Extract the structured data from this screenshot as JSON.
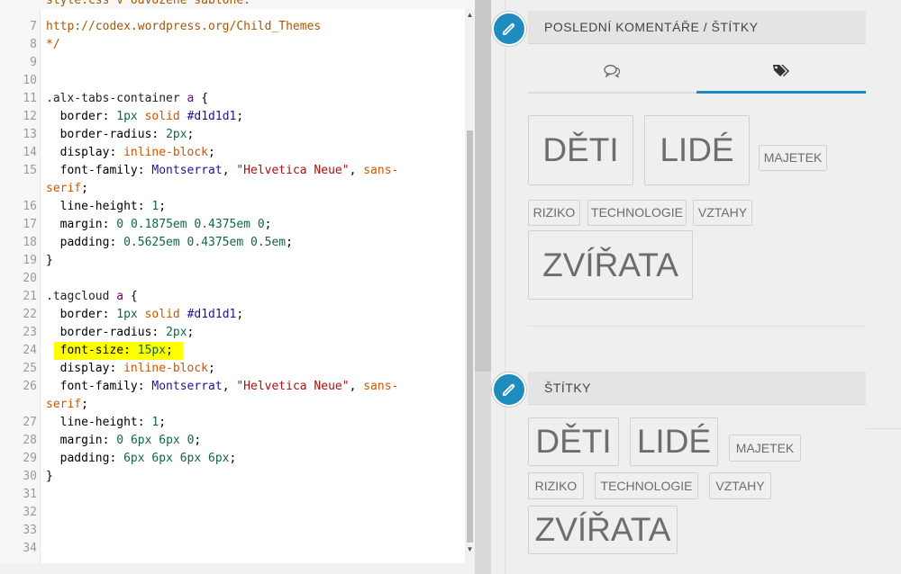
{
  "editor": {
    "lines": [
      {
        "n": "7",
        "tokens": [
          [
            "c-cmt",
            "http://codex.wordpress.org/Child_Themes"
          ]
        ]
      },
      {
        "n": "8",
        "tokens": [
          [
            "c-cmt",
            "*/"
          ]
        ]
      },
      {
        "n": "9",
        "tokens": []
      },
      {
        "n": "10",
        "tokens": []
      },
      {
        "n": "11",
        "tokens": [
          [
            "c-sel",
            ".alx-tabs-container "
          ],
          [
            "c-kw",
            "a"
          ],
          [
            "c-prop",
            " {"
          ]
        ]
      },
      {
        "n": "12",
        "tokens": [
          [
            "c-prop",
            "  border: "
          ],
          [
            "c-val",
            "1px"
          ],
          [
            "c-prop",
            " "
          ],
          [
            "c-atom",
            "solid"
          ],
          [
            "c-prop",
            " "
          ],
          [
            "c-hex",
            "#d1d1d1"
          ],
          [
            "c-prop",
            ";"
          ]
        ]
      },
      {
        "n": "13",
        "tokens": [
          [
            "c-prop",
            "  border-radius: "
          ],
          [
            "c-val",
            "2px"
          ],
          [
            "c-prop",
            ";"
          ]
        ]
      },
      {
        "n": "14",
        "tokens": [
          [
            "c-prop",
            "  display: "
          ],
          [
            "c-atom",
            "inline-block"
          ],
          [
            "c-prop",
            ";"
          ]
        ]
      },
      {
        "n": "15",
        "tokens": [
          [
            "c-prop",
            "  font-family: "
          ],
          [
            "c-hex",
            "Montserrat"
          ],
          [
            "c-prop",
            ", "
          ],
          [
            "c-str",
            "\"Helvetica Neue\""
          ],
          [
            "c-prop",
            ", "
          ],
          [
            "c-atom",
            "sans-"
          ]
        ]
      },
      {
        "n": "",
        "tokens": [
          [
            "c-atom",
            "serif"
          ],
          [
            "c-prop",
            ";"
          ]
        ]
      },
      {
        "n": "16",
        "tokens": [
          [
            "c-prop",
            "  line-height: "
          ],
          [
            "c-val",
            "1"
          ],
          [
            "c-prop",
            ";"
          ]
        ]
      },
      {
        "n": "17",
        "tokens": [
          [
            "c-prop",
            "  margin: "
          ],
          [
            "c-val",
            "0"
          ],
          [
            "c-prop",
            " "
          ],
          [
            "c-val",
            "0.1875em"
          ],
          [
            "c-prop",
            " "
          ],
          [
            "c-val",
            "0.4375em"
          ],
          [
            "c-prop",
            " "
          ],
          [
            "c-val",
            "0"
          ],
          [
            "c-prop",
            ";"
          ]
        ]
      },
      {
        "n": "18",
        "tokens": [
          [
            "c-prop",
            "  padding: "
          ],
          [
            "c-val",
            "0.5625em"
          ],
          [
            "c-prop",
            " "
          ],
          [
            "c-val",
            "0.4375em"
          ],
          [
            "c-prop",
            " "
          ],
          [
            "c-val",
            "0.5em"
          ],
          [
            "c-prop",
            ";"
          ]
        ]
      },
      {
        "n": "19",
        "tokens": [
          [
            "c-prop",
            "}"
          ]
        ]
      },
      {
        "n": "20",
        "tokens": []
      },
      {
        "n": "21",
        "tokens": [
          [
            "c-sel",
            ".tagcloud "
          ],
          [
            "c-kw",
            "a"
          ],
          [
            "c-prop",
            " {"
          ]
        ]
      },
      {
        "n": "22",
        "tokens": [
          [
            "c-prop",
            "  border: "
          ],
          [
            "c-val",
            "1px"
          ],
          [
            "c-prop",
            " "
          ],
          [
            "c-atom",
            "solid"
          ],
          [
            "c-prop",
            " "
          ],
          [
            "c-hex",
            "#d1d1d1"
          ],
          [
            "c-prop",
            ";"
          ]
        ]
      },
      {
        "n": "23",
        "tokens": [
          [
            "c-prop",
            "  border-radius: "
          ],
          [
            "c-val",
            "2px"
          ],
          [
            "c-prop",
            ";"
          ]
        ]
      },
      {
        "n": "24",
        "tokens": [
          [
            "c-prop",
            "  font-size: "
          ],
          [
            "c-val",
            "15px"
          ],
          [
            "c-prop",
            ";"
          ]
        ]
      },
      {
        "n": "25",
        "tokens": [
          [
            "c-prop",
            "  display: "
          ],
          [
            "c-atom",
            "inline-block"
          ],
          [
            "c-prop",
            ";"
          ]
        ]
      },
      {
        "n": "26",
        "tokens": [
          [
            "c-prop",
            "  font-family: "
          ],
          [
            "c-hex",
            "Montserrat"
          ],
          [
            "c-prop",
            ", "
          ],
          [
            "c-str",
            "\"Helvetica Neue\""
          ],
          [
            "c-prop",
            ", "
          ],
          [
            "c-atom",
            "sans-"
          ]
        ]
      },
      {
        "n": "",
        "tokens": [
          [
            "c-atom",
            "serif"
          ],
          [
            "c-prop",
            ";"
          ]
        ]
      },
      {
        "n": "27",
        "tokens": [
          [
            "c-prop",
            "  line-height: "
          ],
          [
            "c-val",
            "1"
          ],
          [
            "c-prop",
            ";"
          ]
        ]
      },
      {
        "n": "28",
        "tokens": [
          [
            "c-prop",
            "  margin: "
          ],
          [
            "c-val",
            "0"
          ],
          [
            "c-prop",
            " "
          ],
          [
            "c-val",
            "6px"
          ],
          [
            "c-prop",
            " "
          ],
          [
            "c-val",
            "6px"
          ],
          [
            "c-prop",
            " "
          ],
          [
            "c-val",
            "0"
          ],
          [
            "c-prop",
            ";"
          ]
        ]
      },
      {
        "n": "29",
        "tokens": [
          [
            "c-prop",
            "  padding: "
          ],
          [
            "c-val",
            "6px"
          ],
          [
            "c-prop",
            " "
          ],
          [
            "c-val",
            "6px"
          ],
          [
            "c-prop",
            " "
          ],
          [
            "c-val",
            "6px"
          ],
          [
            "c-prop",
            " "
          ],
          [
            "c-val",
            "6px"
          ],
          [
            "c-prop",
            ";"
          ]
        ]
      },
      {
        "n": "30",
        "tokens": [
          [
            "c-prop",
            "}"
          ]
        ]
      },
      {
        "n": "31",
        "tokens": []
      },
      {
        "n": "32",
        "tokens": []
      },
      {
        "n": "33",
        "tokens": []
      },
      {
        "n": "34",
        "tokens": []
      }
    ],
    "partial_top_line": "style.css v odvozené šabloně."
  },
  "widget1": {
    "title": "POSLEDNÍ KOMENTÁŘE / ŠTÍTKY",
    "tabs": [
      {
        "icon": "comments-icon",
        "active": false
      },
      {
        "icon": "tags-icon",
        "active": true
      }
    ],
    "tags": [
      "DĚTI",
      "LIDÉ",
      "MAJETEK",
      "RIZIKO",
      "TECHNOLOGIE",
      "VZTAHY",
      "ZVÍŘATA"
    ]
  },
  "widget2": {
    "title": "ŠTÍTKY",
    "tags": [
      "DĚTI",
      "LIDÉ",
      "MAJETEK",
      "RIZIKO",
      "TECHNOLOGIE",
      "VZTAHY",
      "ZVÍŘATA"
    ]
  },
  "colors": {
    "accent": "#1e8cbe",
    "highlight": "#ffff00",
    "tag_border": "#d1d1d1",
    "tag_text": "#6d6d6d"
  }
}
